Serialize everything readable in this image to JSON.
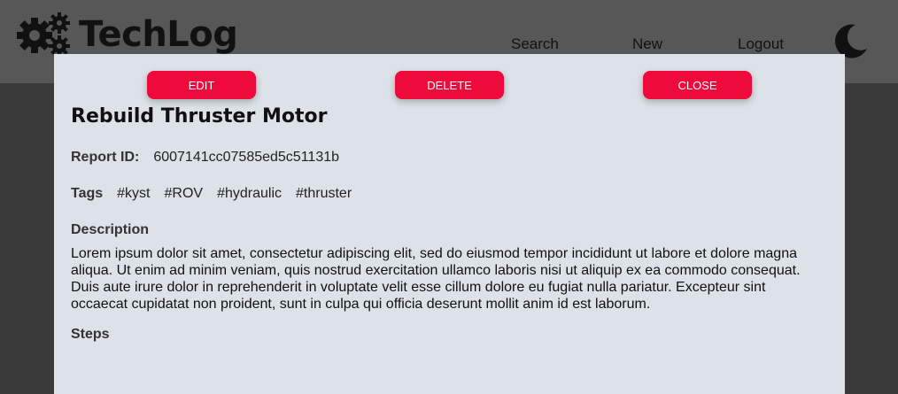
{
  "header": {
    "brand": "TechLog",
    "nav": {
      "search": "Search",
      "new": "New",
      "logout": "Logout"
    },
    "icons": {
      "logo": "gears-icon",
      "theme": "moon-icon"
    }
  },
  "modal": {
    "buttons": {
      "edit": "EDIT",
      "delete": "DELETE",
      "close": "CLOSE"
    },
    "title": "Rebuild Thruster Motor",
    "report_id_label": "Report ID:",
    "report_id": "6007141cc07585ed5c51131b",
    "tags_label": "Tags",
    "tags": [
      "#kyst",
      "#ROV",
      "#hydraulic",
      "#thruster"
    ],
    "description_label": "Description",
    "description": "Lorem ipsum dolor sit amet, consectetur adipiscing elit, sed do eiusmod tempor incididunt ut labore et dolore magna aliqua. Ut enim ad minim veniam, quis nostrud exercitation ullamco laboris nisi ut aliquip ex ea commodo consequat. Duis aute irure dolor in reprehenderit in voluptate velit esse cillum dolore eu fugiat nulla pariatur. Excepteur sint occaecat cupidatat non proident, sunt in culpa qui officia deserunt mollit anim id est laborum.",
    "steps_label": "Steps"
  },
  "colors": {
    "accent": "#ee0a3a",
    "modal_bg": "#dde2e8",
    "header_bg": "#575757",
    "backdrop": "#3a3a3a"
  }
}
